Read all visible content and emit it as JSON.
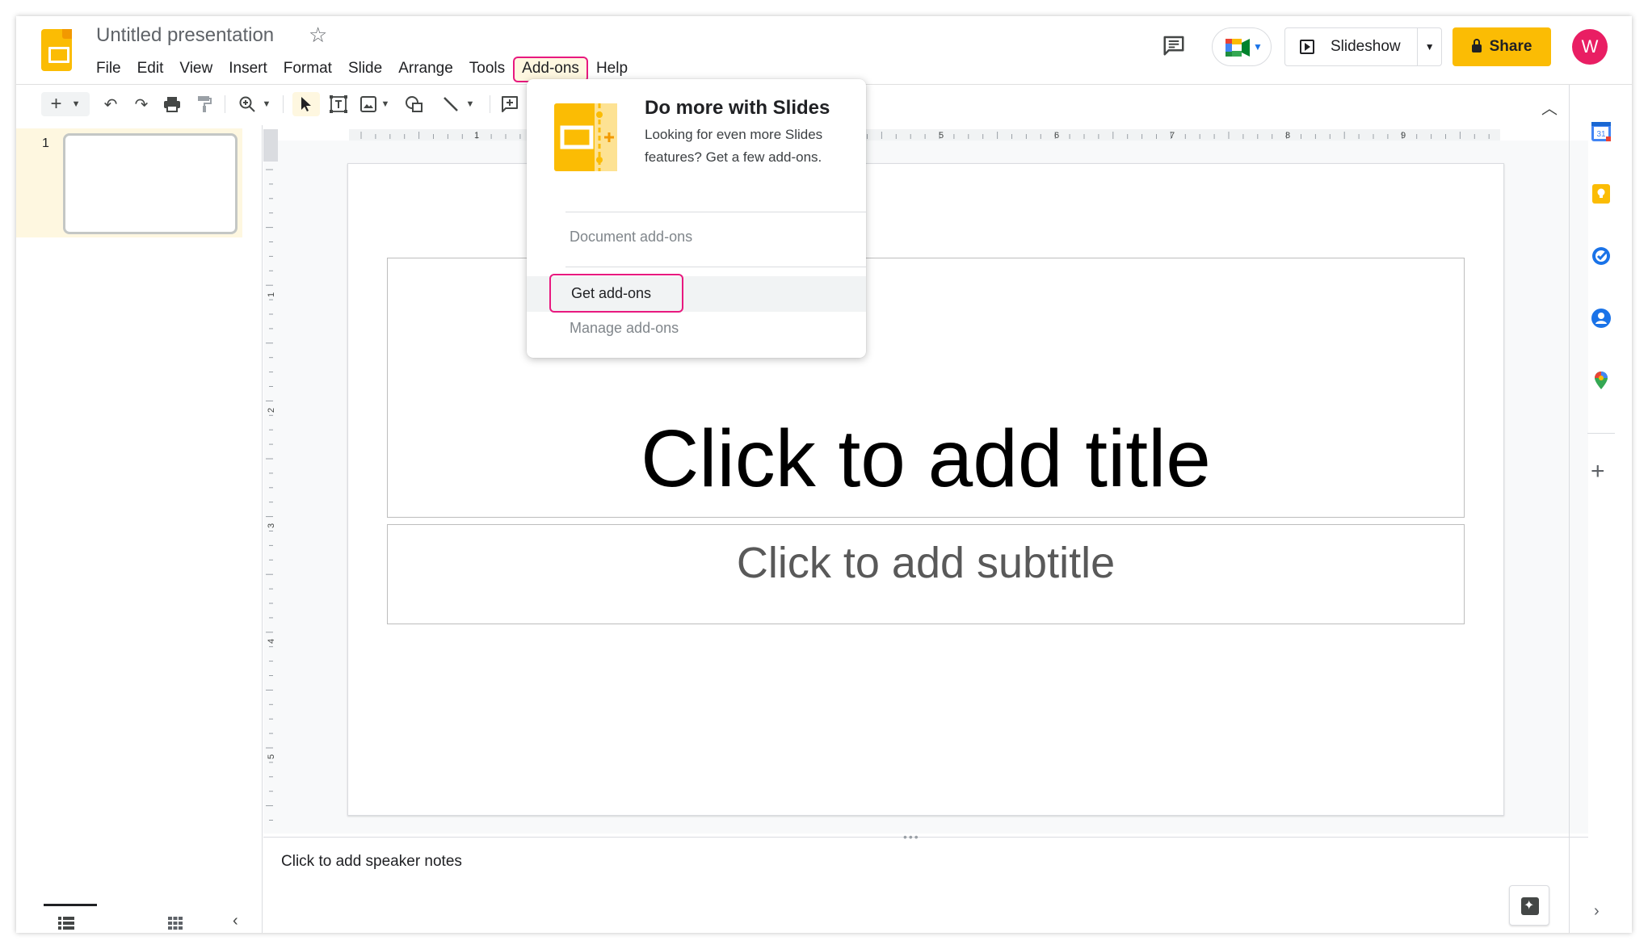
{
  "header": {
    "doc_title": "Untitled presentation",
    "menu": [
      "File",
      "Edit",
      "View",
      "Insert",
      "Format",
      "Slide",
      "Arrange",
      "Tools",
      "Add-ons",
      "Help"
    ],
    "active_menu": "Add-ons",
    "slideshow_label": "Slideshow",
    "share_label": "Share",
    "avatar_initial": "W"
  },
  "ruler": {
    "top_marks": [
      "1",
      "5",
      "6",
      "7",
      "8",
      "9"
    ],
    "left_marks": [
      "1",
      "2",
      "3",
      "4",
      "5"
    ]
  },
  "filmstrip": {
    "slide_number": "1"
  },
  "slide": {
    "title_placeholder": "Click to add title",
    "subtitle_placeholder": "Click to add subtitle"
  },
  "notes": {
    "placeholder": "Click to add speaker notes"
  },
  "addons_menu": {
    "promo_title": "Do more with Slides",
    "promo_text": "Looking for even more Slides features? Get a few add-ons.",
    "document_addons": "Document add-ons",
    "get_addons": "Get add-ons",
    "manage_addons": "Manage add-ons"
  },
  "colors": {
    "brand_yellow": "#fbbc04",
    "highlight_pink": "#e8197f",
    "avatar": "#e91e63"
  }
}
